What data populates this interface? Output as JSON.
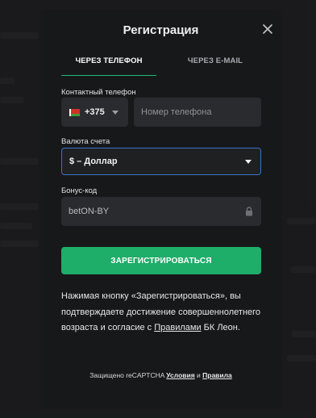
{
  "modal": {
    "title": "Регистрация"
  },
  "tabs": [
    {
      "label": "Через телефон",
      "active": true
    },
    {
      "label": "Через E-mail",
      "active": false
    }
  ],
  "phone": {
    "label": "Контактный телефон",
    "country_flag": "flag-icon-by",
    "country_code": "+375",
    "placeholder": "Номер телефона"
  },
  "currency": {
    "label": "Валюта счета",
    "selected": "$ – Доллар"
  },
  "bonus": {
    "label": "Бонус-код",
    "value": "betON-BY"
  },
  "register_button": "ЗАРЕГИСТРИРОВАТЬСЯ",
  "terms": {
    "text_before": "Нажимая кнопку «Зарегистрироваться», вы подтверждаете достижение совершеннолетнего возраста и согласие с ",
    "link": "Правилами",
    "text_after": " БК Леон."
  },
  "captcha": {
    "text": "Защищено reCAPTCHA ",
    "terms_link": "Условия",
    "and": " и ",
    "privacy_link": "Правила"
  },
  "colors": {
    "accent_green": "#1fad6a",
    "focus_blue": "#3a74c9",
    "modal_bg": "#17181a",
    "field_bg": "#2a2b2e"
  }
}
